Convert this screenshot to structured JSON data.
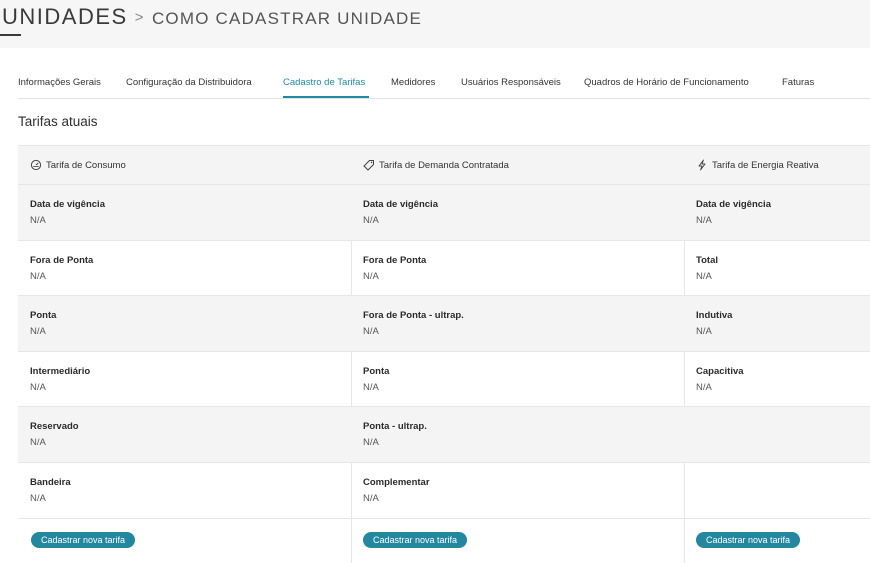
{
  "header": {
    "title": "UNIDADES",
    "separator": ">",
    "subtitle": "COMO CADASTRAR UNIDADE"
  },
  "tabs": [
    {
      "label": "Informações Gerais"
    },
    {
      "label": "Configuração da Distribuidora"
    },
    {
      "label": "Cadastro de Tarifas",
      "active": true
    },
    {
      "label": "Medidores"
    },
    {
      "label": "Usuários Responsáveis"
    },
    {
      "label": "Quadros de Horário de Funcionamento"
    },
    {
      "label": "Faturas"
    }
  ],
  "section_title": "Tarifas atuais",
  "accent_color": "#1f8aa6",
  "button_color": "#23879e",
  "columns": [
    {
      "title": "Tarifa de Consumo",
      "icon": "gauge-icon",
      "rows": [
        {
          "label": "Data de vigência",
          "value": "N/A"
        },
        {
          "label": "Fora de Ponta",
          "value": "N/A"
        },
        {
          "label": "Ponta",
          "value": "N/A"
        },
        {
          "label": "Intermediário",
          "value": "N/A"
        },
        {
          "label": "Reservado",
          "value": "N/A"
        },
        {
          "label": "Bandeira",
          "value": "N/A"
        }
      ],
      "button": "Cadastrar nova tarifa"
    },
    {
      "title": "Tarifa de Demanda Contratada",
      "icon": "tag-icon",
      "rows": [
        {
          "label": "Data de vigência",
          "value": "N/A"
        },
        {
          "label": "Fora de Ponta",
          "value": "N/A"
        },
        {
          "label": "Fora de Ponta - ultrap.",
          "value": "N/A"
        },
        {
          "label": "Ponta",
          "value": "N/A"
        },
        {
          "label": "Ponta - ultrap.",
          "value": "N/A"
        },
        {
          "label": "Complementar",
          "value": "N/A"
        }
      ],
      "button": "Cadastrar nova tarifa"
    },
    {
      "title": "Tarifa de Energia Reativa",
      "icon": "lightning-icon",
      "rows": [
        {
          "label": "Data de vigência",
          "value": "N/A"
        },
        {
          "label": "Total",
          "value": "N/A"
        },
        {
          "label": "Indutiva",
          "value": "N/A"
        },
        {
          "label": "Capacitiva",
          "value": "N/A"
        },
        {
          "label": "",
          "value": ""
        },
        {
          "label": "",
          "value": ""
        }
      ],
      "button": "Cadastrar nova tarifa"
    }
  ]
}
